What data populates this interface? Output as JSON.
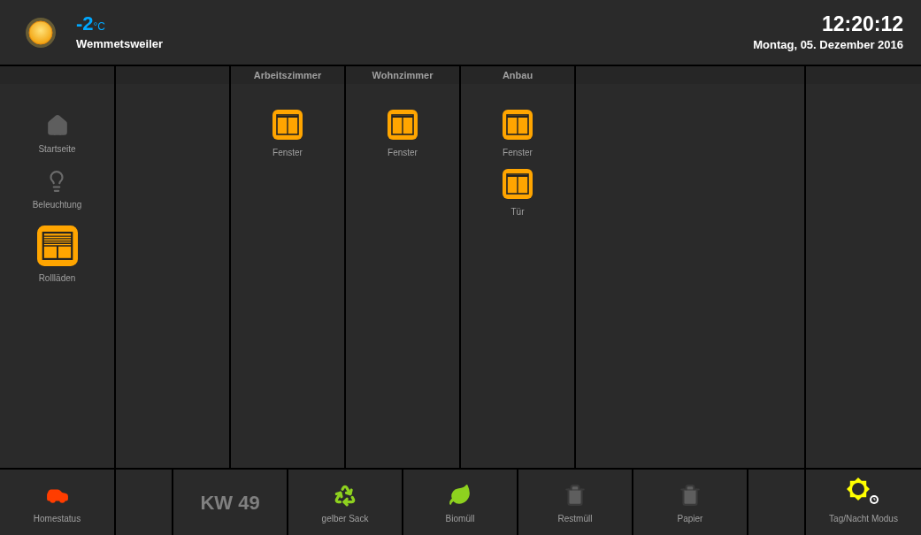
{
  "header": {
    "temperature": "-2",
    "unit": "°C",
    "location": "Wemmetsweiler",
    "time": "12:20:12",
    "date": "Montag, 05. Dezember 2016"
  },
  "sidebar": {
    "items": [
      {
        "label": "Startseite",
        "kind": "home",
        "selected": false
      },
      {
        "label": "Beleuchtung",
        "kind": "bulb",
        "selected": false
      },
      {
        "label": "Rollläden",
        "kind": "shutter",
        "selected": true
      }
    ]
  },
  "rooms": [
    {
      "title": "Arbeitszimmer",
      "items": [
        {
          "label": "Fenster"
        }
      ]
    },
    {
      "title": "Wohnzimmer",
      "items": [
        {
          "label": "Fenster"
        }
      ]
    },
    {
      "title": "Anbau",
      "items": [
        {
          "label": "Fenster"
        },
        {
          "label": "Tür"
        }
      ]
    }
  ],
  "footer": [
    {
      "kind": "car",
      "label": "Homestatus",
      "color": "#ff3d00"
    },
    {
      "kind": "empty"
    },
    {
      "kind": "week",
      "label": "KW 49"
    },
    {
      "kind": "recycle",
      "label": "gelber Sack",
      "color": "#8ed11f"
    },
    {
      "kind": "leaf",
      "label": "Biomüll",
      "color": "#8ed11f"
    },
    {
      "kind": "trash",
      "label": "Restmüll",
      "color": "#5e5e5e"
    },
    {
      "kind": "trash",
      "label": "Papier",
      "color": "#5e5e5e"
    },
    {
      "kind": "empty"
    },
    {
      "kind": "sun",
      "label": "Tag/Nacht Modus",
      "color": "#ffff00"
    }
  ]
}
